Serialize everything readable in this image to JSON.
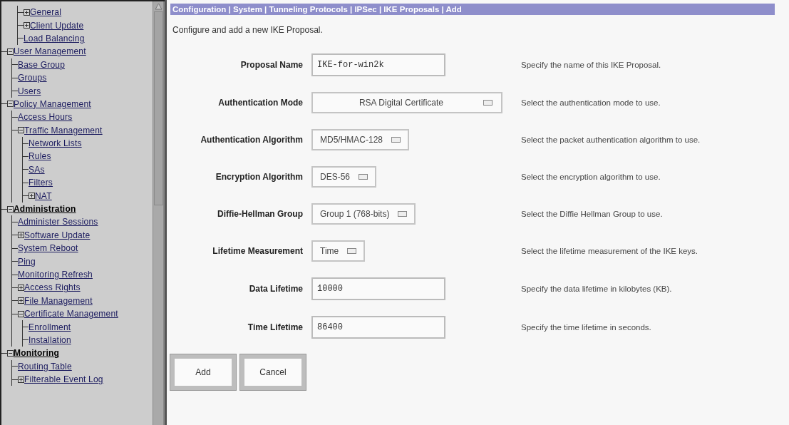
{
  "sidebar": {
    "tree": [
      {
        "children": [
          {
            "label": "General",
            "kind": "link",
            "expanded": false
          },
          {
            "label": "Client Update",
            "kind": "link",
            "expanded": false
          },
          {
            "label": "Load Balancing",
            "kind": "link"
          }
        ]
      },
      {
        "label": "User Management",
        "kind": "link",
        "expanded": true,
        "children": [
          {
            "label": "Base Group",
            "kind": "link"
          },
          {
            "label": "Groups",
            "kind": "link"
          },
          {
            "label": "Users",
            "kind": "link"
          }
        ]
      },
      {
        "label": "Policy Management",
        "kind": "link",
        "expanded": true,
        "children": [
          {
            "label": "Access Hours",
            "kind": "link"
          },
          {
            "label": "Traffic Management",
            "kind": "link",
            "expanded": true,
            "children": [
              {
                "label": "Network Lists",
                "kind": "link"
              },
              {
                "label": "Rules",
                "kind": "link"
              },
              {
                "label": "SAs",
                "kind": "link"
              },
              {
                "label": "Filters",
                "kind": "link"
              },
              {
                "label": "NAT",
                "kind": "link",
                "expanded": false
              }
            ]
          }
        ]
      },
      {
        "label": "Administration",
        "kind": "section",
        "expanded": true,
        "children": [
          {
            "label": "Administer Sessions",
            "kind": "link"
          },
          {
            "label": "Software Update",
            "kind": "link",
            "expanded": false
          },
          {
            "label": "System Reboot",
            "kind": "link"
          },
          {
            "label": "Ping",
            "kind": "link"
          },
          {
            "label": "Monitoring Refresh",
            "kind": "link"
          },
          {
            "label": "Access Rights",
            "kind": "link",
            "expanded": false
          },
          {
            "label": "File Management",
            "kind": "link",
            "expanded": false
          },
          {
            "label": "Certificate Management",
            "kind": "link",
            "expanded": true,
            "children": [
              {
                "label": "Enrollment",
                "kind": "link"
              },
              {
                "label": "Installation",
                "kind": "link"
              }
            ]
          }
        ]
      },
      {
        "label": "Monitoring",
        "kind": "section",
        "expanded": true,
        "children": [
          {
            "label": "Routing Table",
            "kind": "link"
          },
          {
            "label": "Filterable Event Log",
            "kind": "link",
            "expanded": false
          }
        ]
      }
    ]
  },
  "breadcrumb": "Configuration | System | Tunneling Protocols | IPSec | IKE Proposals | Add",
  "intro": "Configure and add a new IKE Proposal.",
  "fields": [
    {
      "label": "Proposal Name",
      "kind": "text",
      "value": "IKE-for-win2k",
      "help": "Specify the name of this IKE Proposal."
    },
    {
      "label": "Authentication Mode",
      "kind": "select",
      "value": "RSA Digital Certificate",
      "help": "Select the authentication mode to use."
    },
    {
      "label": "Authentication Algorithm",
      "kind": "select",
      "value": "MD5/HMAC-128",
      "help": "Select the packet authentication algorithm to use."
    },
    {
      "label": "Encryption Algorithm",
      "kind": "select",
      "value": "DES-56",
      "help": "Select the encryption algorithm to use."
    },
    {
      "label": "Diffie-Hellman Group",
      "kind": "select",
      "value": "Group 1 (768-bits)",
      "help": "Select the Diffie Hellman Group to use."
    },
    {
      "label": "Lifetime Measurement",
      "kind": "select",
      "value": "Time",
      "help": "Select the lifetime measurement of the IKE keys."
    },
    {
      "label": "Data Lifetime",
      "kind": "text",
      "value": "10000",
      "help": "Specify the data lifetime in kilobytes (KB)."
    },
    {
      "label": "Time Lifetime",
      "kind": "text",
      "value": "86400",
      "help": "Specify the time lifetime in seconds."
    }
  ],
  "buttons": [
    "Add",
    "Cancel"
  ]
}
